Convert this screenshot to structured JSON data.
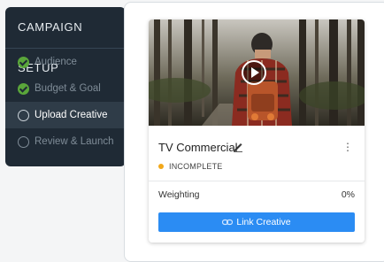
{
  "sidebar": {
    "title": "CAMPAIGN SETUP",
    "items": [
      {
        "label": "Audience",
        "state": "complete"
      },
      {
        "label": "Budget & Goal",
        "state": "complete"
      },
      {
        "label": "Upload Creative",
        "state": "active"
      },
      {
        "label": "Review & Launch",
        "state": "pending"
      }
    ]
  },
  "card": {
    "title": "TV Commercial",
    "status": "INCOMPLETE",
    "status_color": "#f2a81b",
    "weighting_label": "Weighting",
    "weighting_value": "0%",
    "button_label": "Link Creative",
    "more_icon": "⋮"
  },
  "colors": {
    "sidebar_bg": "#1f2a35",
    "accent": "#2b8cf3",
    "check": "#5aa63a"
  }
}
